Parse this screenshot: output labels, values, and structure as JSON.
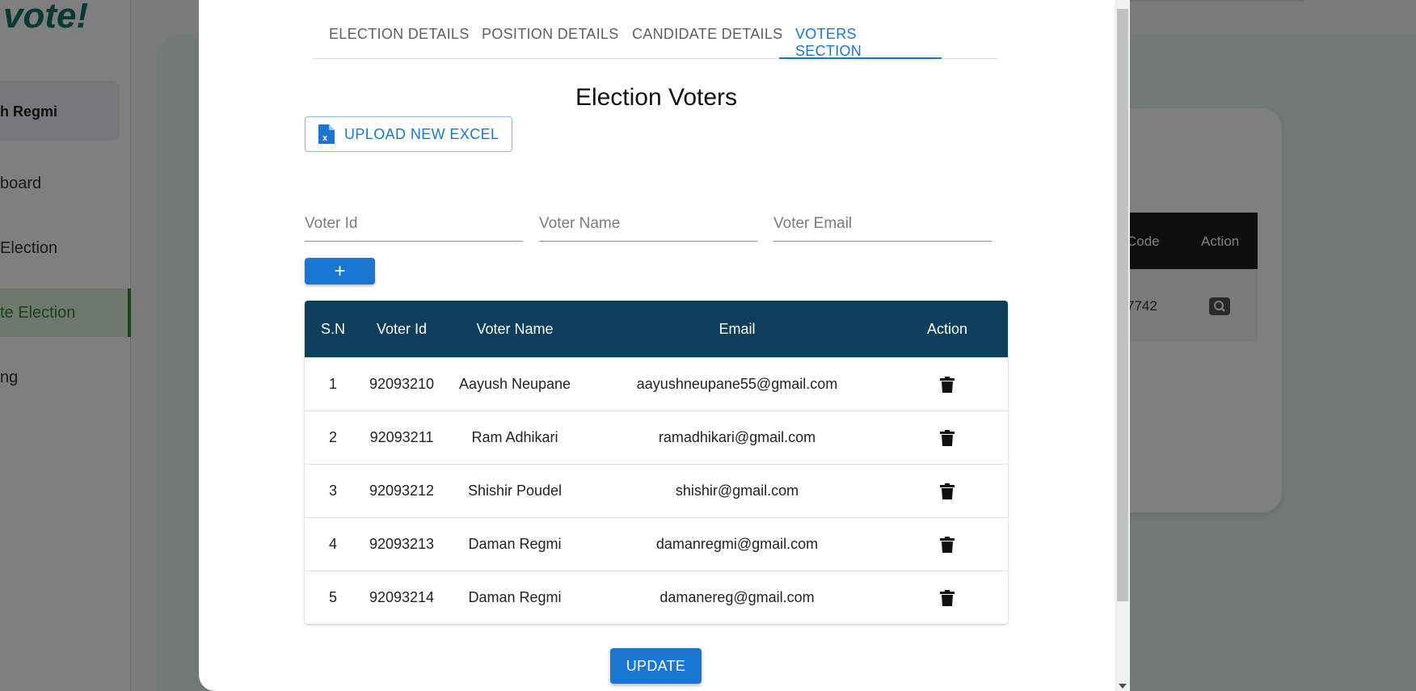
{
  "background": {
    "logo_text": "vote!",
    "user_name": "h Regmi",
    "nav": [
      {
        "label": "board"
      },
      {
        "label": "Election"
      },
      {
        "label": "te Election"
      },
      {
        "label": "ng"
      }
    ],
    "table": {
      "headers": [
        "Code",
        "Action"
      ],
      "row_code": "7742"
    }
  },
  "modal": {
    "tabs": [
      {
        "label": "ELECTION DETAILS"
      },
      {
        "label": "POSITION DETAILS"
      },
      {
        "label": "CANDIDATE DETAILS"
      },
      {
        "label": "VOTERS SECTION"
      }
    ],
    "active_tab": "VOTERS SECTION",
    "title": "Election Voters",
    "upload_label": "UPLOAD NEW EXCEL",
    "inputs": {
      "voter_id_placeholder": "Voter Id",
      "voter_name_placeholder": "Voter Name",
      "voter_email_placeholder": "Voter Email"
    },
    "add_label": "+",
    "table": {
      "headers": [
        "S.N",
        "Voter Id",
        "Voter Name",
        "Email",
        "Action"
      ],
      "rows": [
        {
          "sn": "1",
          "id": "92093210",
          "name": "Aayush Neupane",
          "email": "aayushneupane55@gmail.com"
        },
        {
          "sn": "2",
          "id": "92093211",
          "name": "Ram Adhikari",
          "email": "ramadhikari@gmail.com"
        },
        {
          "sn": "3",
          "id": "92093212",
          "name": "Shishir Poudel",
          "email": "shishir@gmail.com"
        },
        {
          "sn": "4",
          "id": "92093213",
          "name": "Daman Regmi",
          "email": "damanregmi@gmail.com"
        },
        {
          "sn": "5",
          "id": "92093214",
          "name": "Daman Regmi",
          "email": "damanereg@gmail.com"
        }
      ]
    },
    "update_label": "UPDATE"
  },
  "colors": {
    "accent": "#1976d2",
    "table_header": "#0d3f5c",
    "brand_green": "#14706a"
  },
  "icons": {
    "upload": "excel-file-icon",
    "delete": "trash-icon",
    "search": "search-icon"
  }
}
